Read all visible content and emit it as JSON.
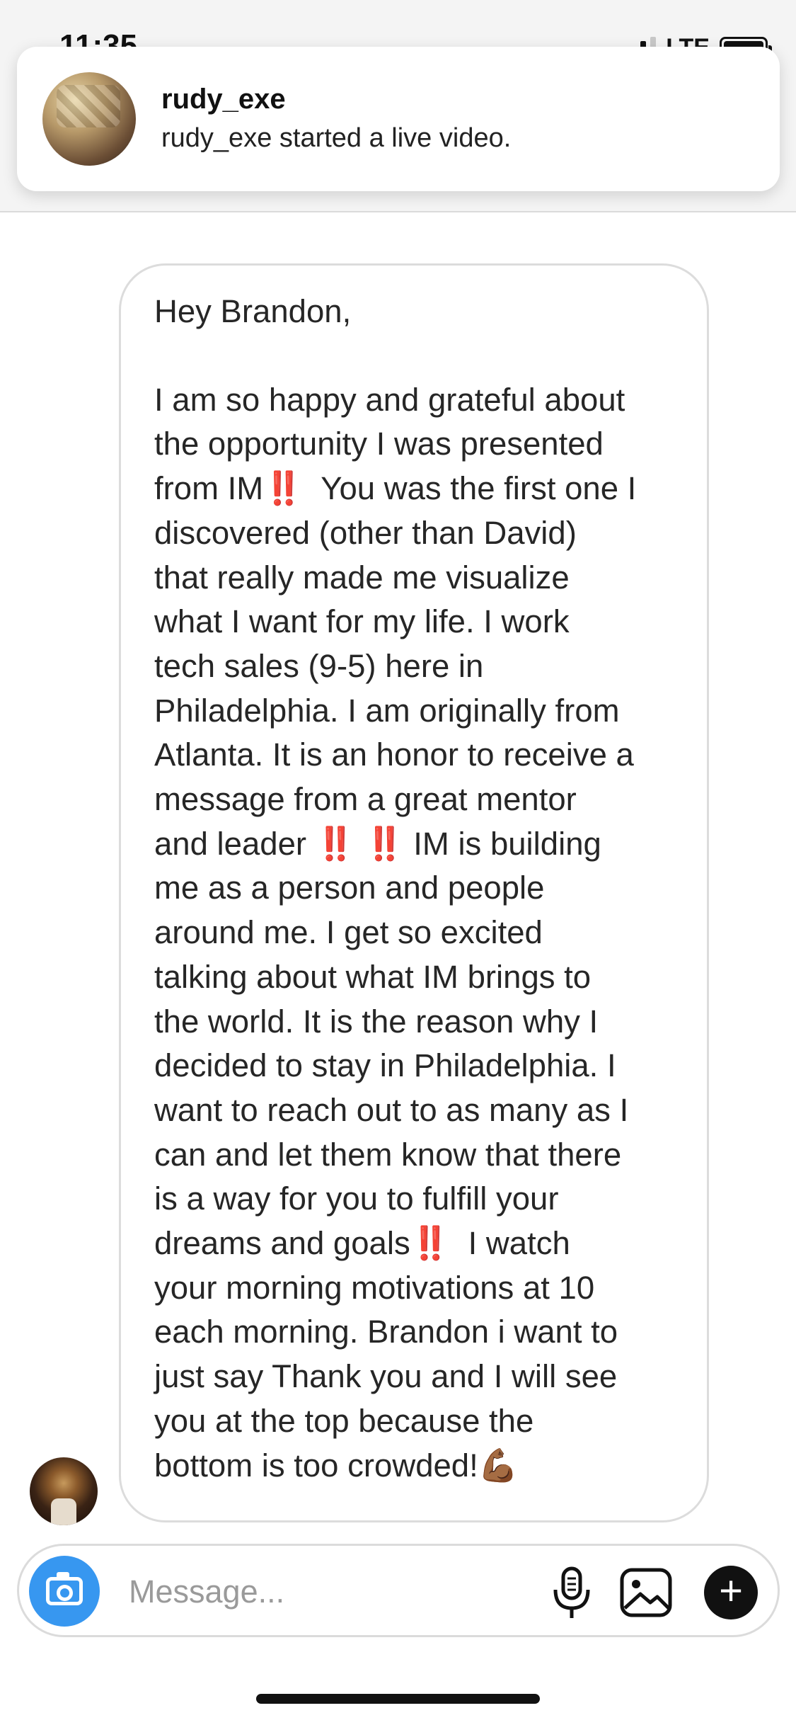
{
  "status_bar": {
    "time": "11:35",
    "network": "LTE"
  },
  "notification": {
    "username": "rudy_exe",
    "text": "rudy_exe started a live video."
  },
  "message": {
    "greeting": "Hey Brandon,",
    "body": "I am so happy and grateful about\nthe opportunity I was presented\nfrom IM‼️  You was the first one I\ndiscovered (other than David)\nthat really made me visualize\nwhat I want for my life. I work\ntech sales (9-5) here in\nPhiladelphia. I am originally from\nAtlanta. It is an honor to receive a\nmessage from a great mentor\nand leader ‼️ ‼️ IM is building\nme as a person and people\naround me. I get so excited\ntalking about what IM brings to\nthe world. It is the reason why I\ndecided to stay in Philadelphia. I\nwant to reach out to as many as I\ncan and let them know that there\nis a way for you to fulfill your\ndreams and goals‼️  I watch\nyour morning motivations at 10\neach morning. Brandon i want to\njust say Thank you and I will see\nyou at the top because the\nbottom is too crowded!💪🏾"
  },
  "composer": {
    "placeholder": "Message..."
  },
  "icons": {
    "camera": "camera-icon",
    "microphone": "microphone-icon",
    "gallery": "gallery-icon",
    "add": "plus-icon"
  },
  "colors": {
    "camera_button": "#3797f0",
    "bubble_border": "#dcdcdc"
  }
}
